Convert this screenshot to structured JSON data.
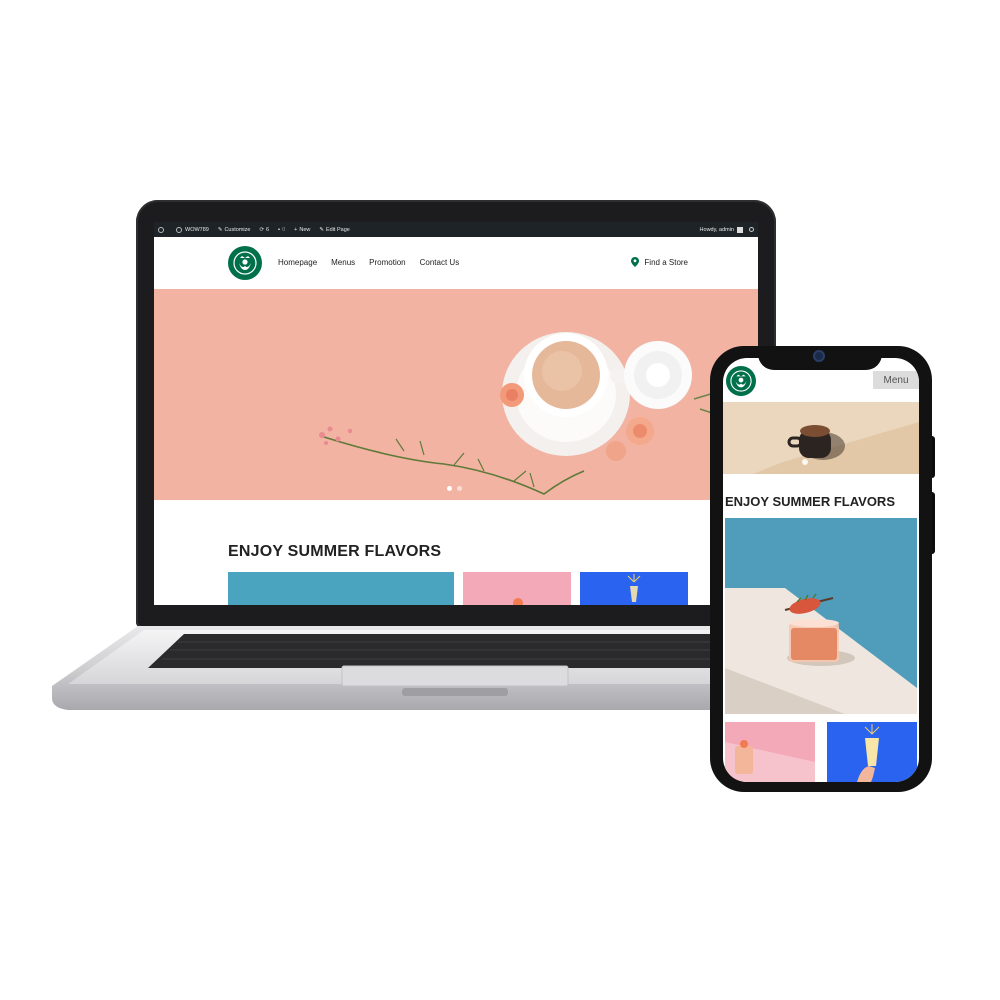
{
  "admin_bar": {
    "site_name": "WOW789",
    "customize": "Customize",
    "updates_count": "6",
    "comments_count": "0",
    "new_label": "New",
    "edit_page": "Edit Page",
    "greeting": "Howdy, admin"
  },
  "header": {
    "nav_items": [
      "Homepage",
      "Menus",
      "Promotion",
      "Contact Us"
    ],
    "find_store": "Find a Store"
  },
  "hero": {
    "slide_count": 2,
    "active_slide": 1
  },
  "section": {
    "title": "ENJOY SUMMER FLAVORS"
  },
  "mobile": {
    "menu_button": "Menu",
    "section_title": "ENJOY SUMMER FLAVORS"
  },
  "colors": {
    "brand_green": "#00704a",
    "admin_bar": "#1d2327",
    "hero_peach": "#f2b3a2",
    "card_teal": "#4aa3bf",
    "card_pink": "#f4a9b8",
    "card_blue": "#2a63f0"
  },
  "icons": [
    "wordpress-icon",
    "dashboard-icon",
    "brush-icon",
    "refresh-icon",
    "comment-icon",
    "plus-icon",
    "pencil-icon",
    "search-icon",
    "map-pin-icon",
    "mermaid-logo-icon"
  ]
}
